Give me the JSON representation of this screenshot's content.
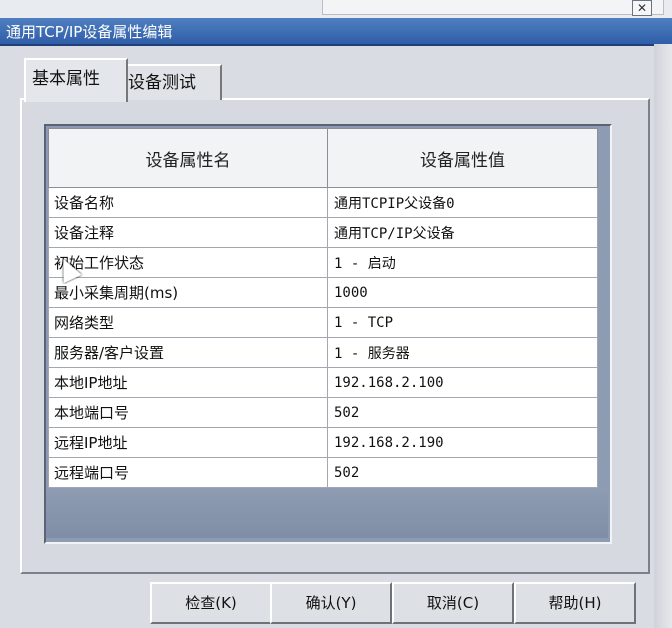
{
  "window": {
    "title": "通用TCP/IP设备属性编辑",
    "close_glyph": "✕"
  },
  "tabs": [
    {
      "label": "基本属性",
      "active": true
    },
    {
      "label": "设备测试",
      "active": false
    }
  ],
  "table": {
    "headers": [
      "设备属性名",
      "设备属性值"
    ],
    "rows": [
      {
        "name": "设备名称",
        "value": "通用TCPIP父设备0"
      },
      {
        "name": "设备注释",
        "value": "通用TCP/IP父设备"
      },
      {
        "name": "初始工作状态",
        "value": "1 - 启动"
      },
      {
        "name": "最小采集周期(ms)",
        "value": "1000"
      },
      {
        "name": "网络类型",
        "value": "1 - TCP"
      },
      {
        "name": "服务器/客户设置",
        "value": "1 - 服务器"
      },
      {
        "name": "本地IP地址",
        "value": "192.168.2.100"
      },
      {
        "name": "本地端口号",
        "value": "502"
      },
      {
        "name": "远程IP地址",
        "value": "192.168.2.190"
      },
      {
        "name": "远程端口号",
        "value": "502"
      }
    ]
  },
  "buttons": {
    "check": "检查(K)",
    "ok": "确认(Y)",
    "cancel": "取消(C)",
    "help": "帮助(H)"
  }
}
